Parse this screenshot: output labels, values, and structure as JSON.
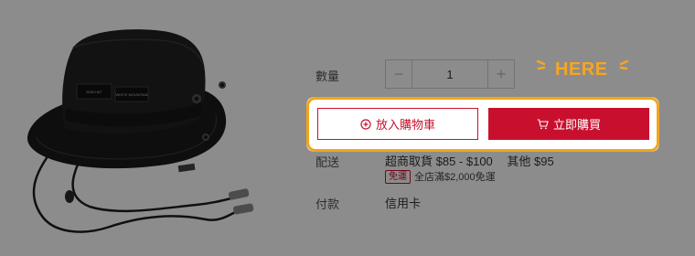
{
  "product": {
    "image_icon": "bucket-hat-image",
    "hat_tag_text_left": "BOB HAT",
    "hat_tag_text_right": "WHITE MOUNTAIN"
  },
  "quantity": {
    "label": "數量",
    "value": "1",
    "minus": "−",
    "plus": "+"
  },
  "actions": {
    "add_to_cart": "放入購物車",
    "buy_now": "立即購買",
    "add_icon": "plus-circle-icon",
    "cart_icon": "cart-icon"
  },
  "shipping": {
    "label": "配送",
    "method": "超商取貨 $85 - $100",
    "other": "其他 $95",
    "free_badge": "免運",
    "free_text": "全店滿$2,000免運"
  },
  "payment": {
    "label": "付款",
    "value": "信用卡"
  },
  "callout": {
    "text": "HERE"
  },
  "colors": {
    "brand": "#c8102e",
    "highlight": "#f2a51a",
    "dim_overlay": "rgba(0,0,0,0.45)"
  }
}
